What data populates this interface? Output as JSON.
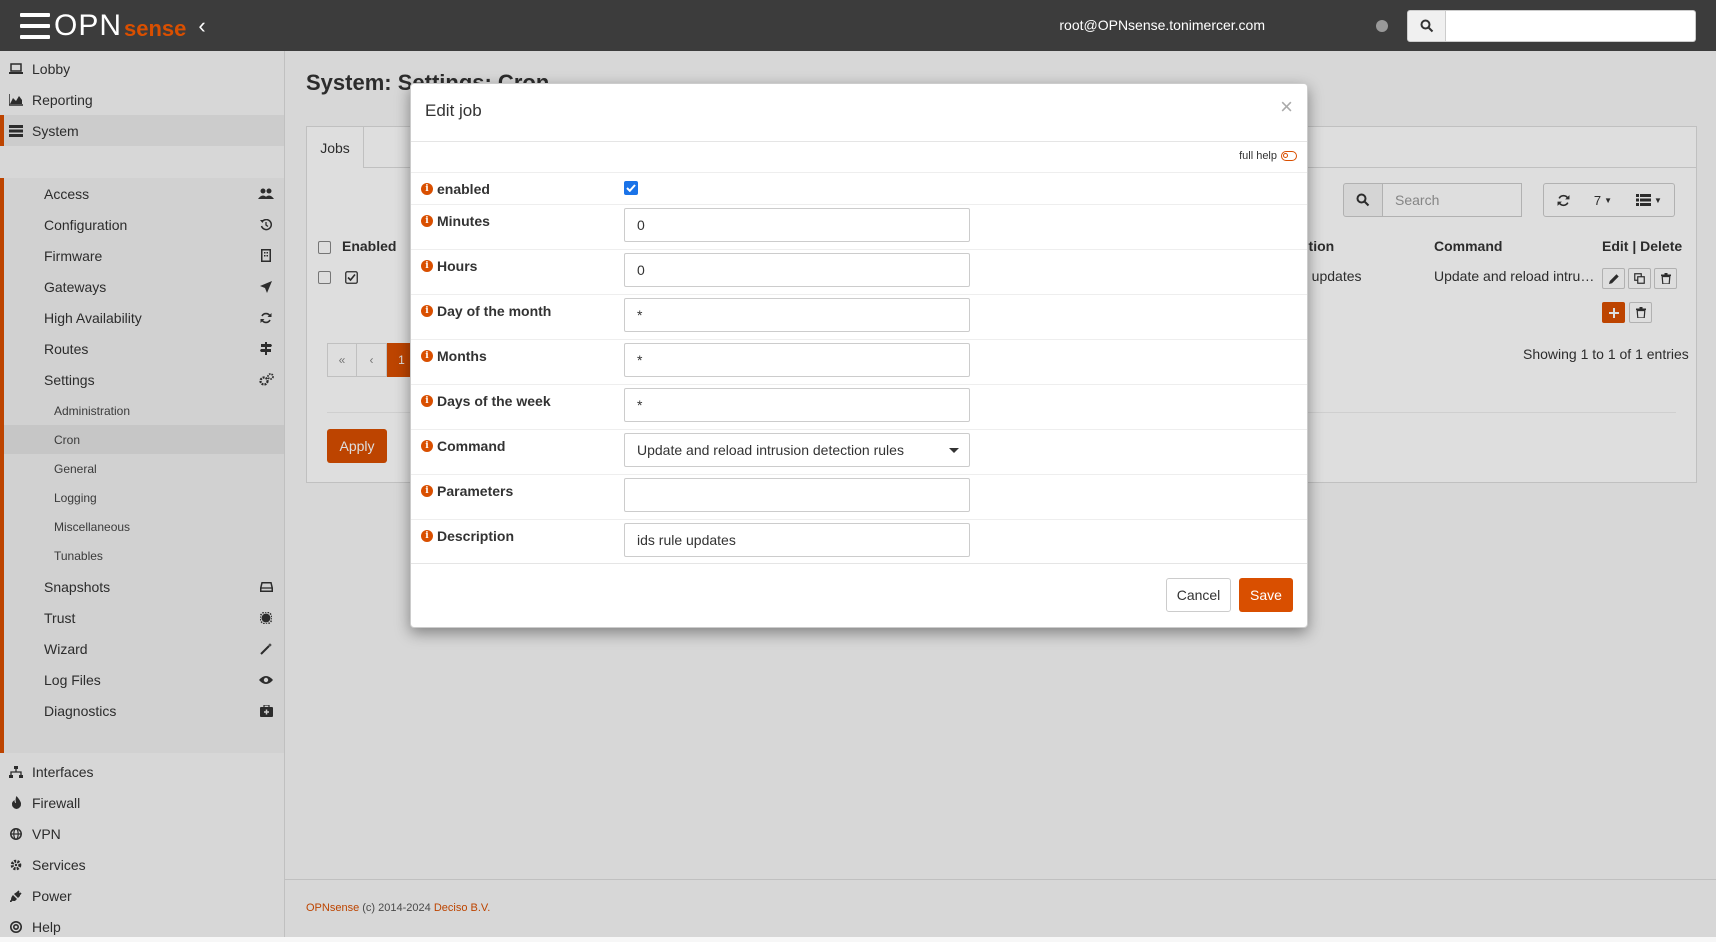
{
  "app": {
    "logo_main": "OPN",
    "logo_accent": "sense",
    "user": "root@OPNsense.tonimercer.com"
  },
  "colors": {
    "accent": "#d94f00",
    "navbar": "#3c3c3c",
    "checkbox": "#1a73e8"
  },
  "menu": {
    "lobby": "Lobby",
    "reporting": "Reporting",
    "system": "System",
    "interfaces": "Interfaces",
    "firewall": "Firewall",
    "vpn": "VPN",
    "services": "Services",
    "power": "Power",
    "help": "Help"
  },
  "system_sub": {
    "access": "Access",
    "configuration": "Configuration",
    "firmware": "Firmware",
    "gateways": "Gateways",
    "high_availability": "High Availability",
    "routes": "Routes",
    "settings": "Settings",
    "snapshots": "Snapshots",
    "trust": "Trust",
    "wizard": "Wizard",
    "log_files": "Log Files",
    "diagnostics": "Diagnostics"
  },
  "settings_sub": {
    "administration": "Administration",
    "cron": "Cron",
    "general": "General",
    "logging": "Logging",
    "miscellaneous": "Miscellaneous",
    "tunables": "Tunables"
  },
  "page": {
    "title": "System: Settings: Cron",
    "tab": "Jobs",
    "search_placeholder": "Search",
    "rows_per_page": "7",
    "columns": {
      "enabled": "Enabled",
      "description": "ption",
      "command": "Command",
      "edit_delete": "Edit | Delete"
    },
    "row": {
      "description": "e updates",
      "command": "Update and reload intru…"
    },
    "pager": {
      "first": "«",
      "prev": "‹",
      "current": "1"
    },
    "showing": "Showing 1 to 1 of 1 entries",
    "apply": "Apply"
  },
  "modal": {
    "title": "Edit job",
    "close": "×",
    "full_help": "full help",
    "fields": {
      "enabled": {
        "label": "enabled",
        "checked": true
      },
      "minutes": {
        "label": "Minutes",
        "value": "0"
      },
      "hours": {
        "label": "Hours",
        "value": "0"
      },
      "day_of_month": {
        "label": "Day of the month",
        "value": "*"
      },
      "months": {
        "label": "Months",
        "value": "*"
      },
      "days_of_week": {
        "label": "Days of the week",
        "value": "*"
      },
      "command": {
        "label": "Command",
        "value": "Update and reload intrusion detection rules"
      },
      "parameters": {
        "label": "Parameters",
        "value": ""
      },
      "description": {
        "label": "Description",
        "value": "ids rule updates"
      }
    },
    "cancel": "Cancel",
    "save": "Save"
  },
  "footer": {
    "org": "OPNsense",
    "copyright": "(c) 2014-2024",
    "company": "Deciso B.V."
  }
}
